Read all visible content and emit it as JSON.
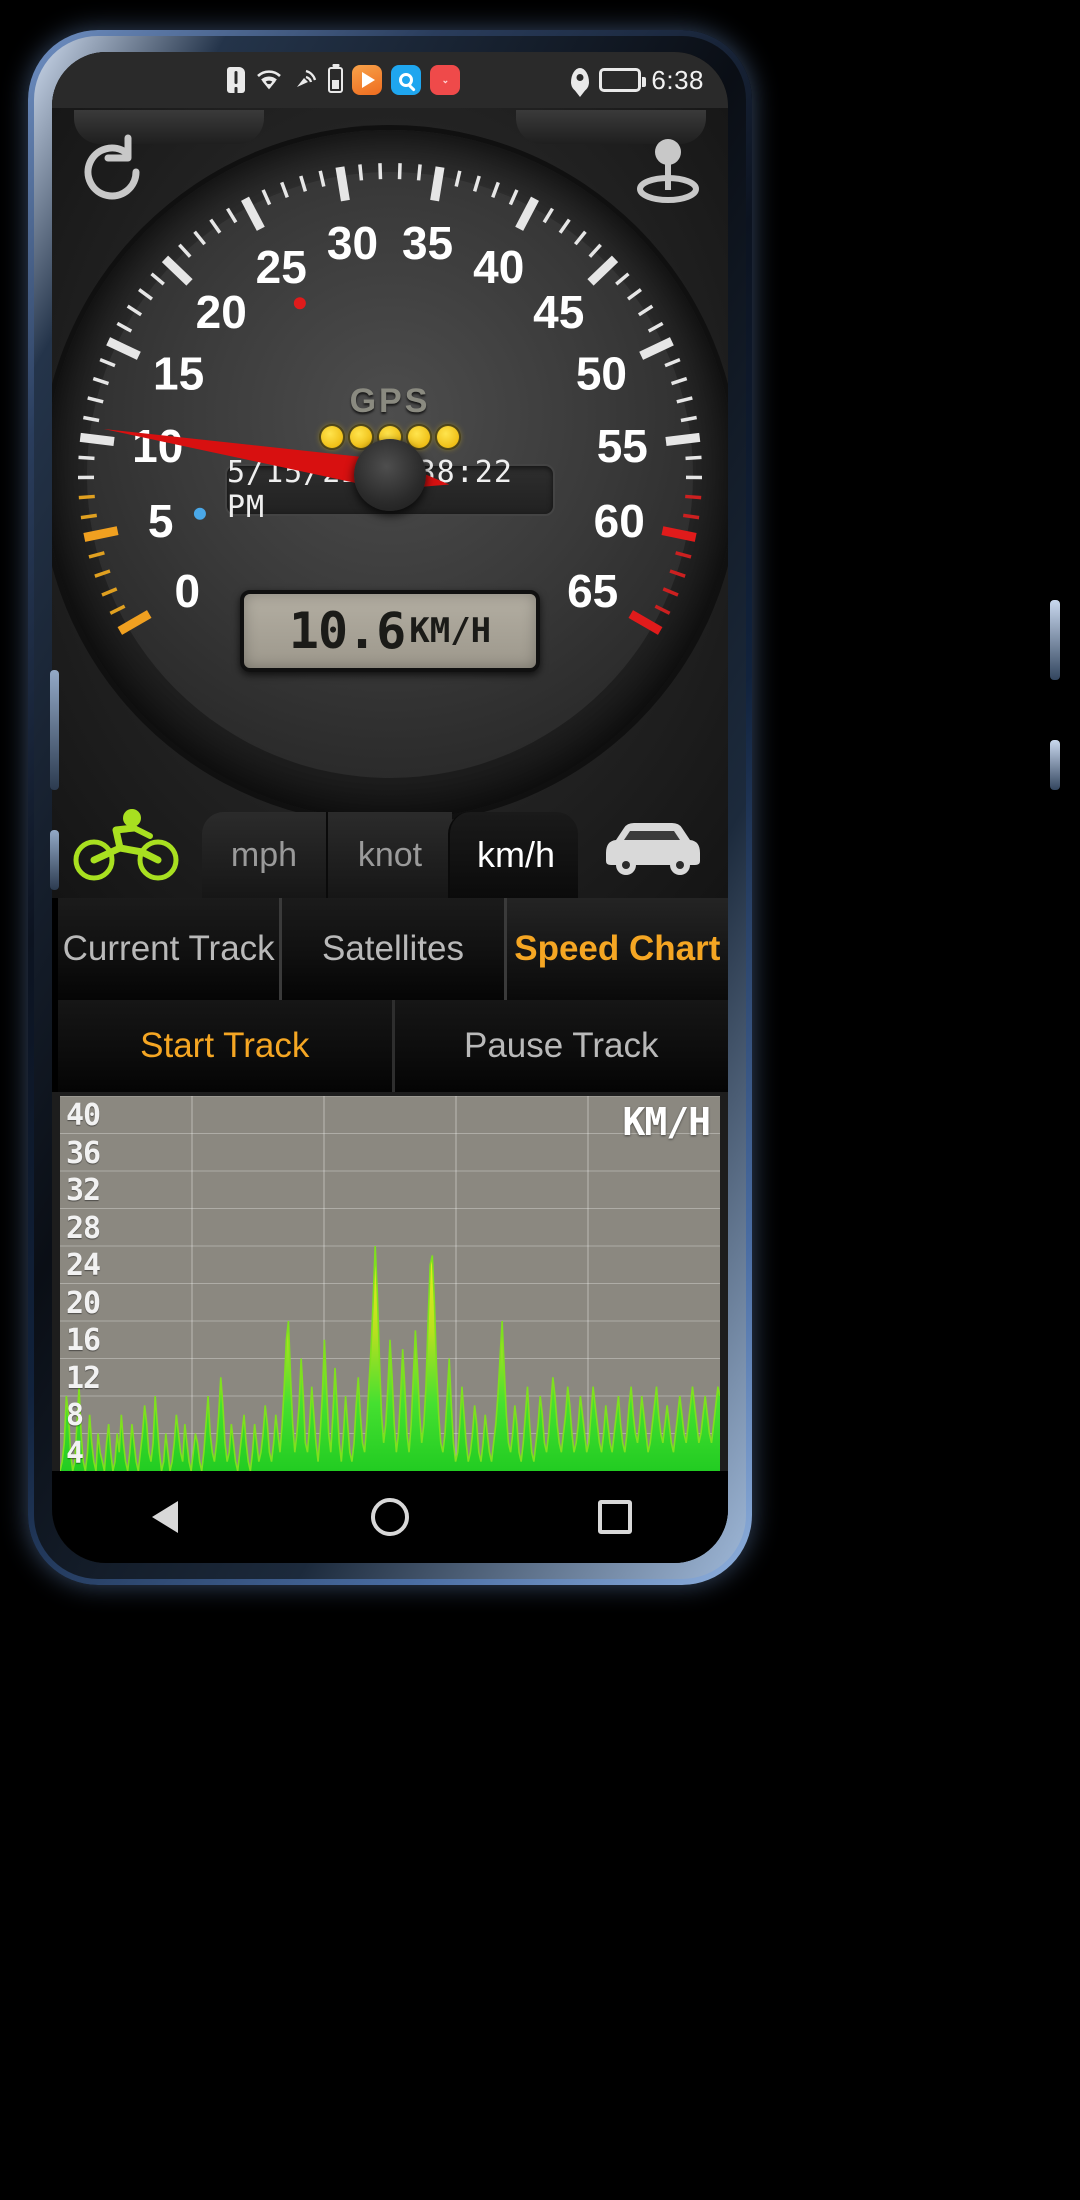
{
  "statusbar": {
    "icons": [
      "sim-alert-icon",
      "wifi-icon",
      "mobile-signal-icon",
      "battery-small-icon",
      "video-app-icon",
      "search-app-icon",
      "shopping-app-icon"
    ],
    "location_icon": "location-pin-icon",
    "battery_icon": "battery-icon",
    "time": "6:38"
  },
  "gauge": {
    "refresh_icon": "refresh-icon",
    "gps_fix_icon": "gps-fix-icon",
    "gps_label": "GPS",
    "gps_signal_dots": 5,
    "datetime": "5/15/22 6:38:22 PM",
    "speed_value": "10.6",
    "speed_unit": "KM/H",
    "needle_speed": 10.6,
    "scale_max": 65,
    "scale_min": 0,
    "major_ticks": [
      "0",
      "5",
      "10",
      "15",
      "20",
      "25",
      "30",
      "35",
      "40",
      "45",
      "50",
      "55",
      "60",
      "65"
    ],
    "accent_orange": "#f0a020",
    "accent_red": "#e01b1b",
    "needle_color": "#d81010"
  },
  "unit_bar": {
    "bicycle_icon": "bicycle-icon",
    "car_icon": "car-icon",
    "units": [
      {
        "label": "mph",
        "active": false
      },
      {
        "label": "knot",
        "active": false
      },
      {
        "label": "km/h",
        "active": true
      }
    ]
  },
  "main_tabs": [
    {
      "label": "Current Track",
      "active": false
    },
    {
      "label": "Satellites",
      "active": false
    },
    {
      "label": "Speed Chart",
      "active": true
    }
  ],
  "track_tabs": [
    {
      "label": "Start Track",
      "active": true
    },
    {
      "label": "Pause Track",
      "active": false
    }
  ],
  "chart_data": {
    "type": "area",
    "title": "",
    "unit_label": "KM/H",
    "ylabel": "",
    "xlabel": "",
    "ylim": [
      0,
      40
    ],
    "yticks": [
      40,
      36,
      32,
      28,
      24,
      20,
      16,
      12,
      8,
      4
    ],
    "grid": true,
    "gridlines_vertical": 4,
    "series": [
      {
        "name": "speed",
        "color_low": "#3ee03e",
        "color_high": "#e8e020",
        "values": [
          0,
          1,
          3,
          8,
          6,
          2,
          0,
          1,
          5,
          9,
          4,
          1,
          0,
          2,
          6,
          3,
          1,
          0,
          4,
          2,
          1,
          0,
          3,
          5,
          2,
          0,
          1,
          4,
          2,
          6,
          3,
          1,
          0,
          2,
          5,
          3,
          1,
          0,
          2,
          4,
          7,
          5,
          2,
          1,
          3,
          8,
          5,
          2,
          0,
          1,
          4,
          2,
          0,
          1,
          3,
          6,
          4,
          2,
          1,
          5,
          3,
          1,
          0,
          2,
          4,
          3,
          1,
          0,
          2,
          5,
          8,
          4,
          2,
          1,
          3,
          6,
          10,
          7,
          3,
          1,
          2,
          5,
          3,
          1,
          0,
          2,
          4,
          6,
          3,
          1,
          0,
          2,
          5,
          3,
          1,
          2,
          4,
          7,
          5,
          2,
          1,
          3,
          6,
          4,
          2,
          5,
          9,
          14,
          16,
          10,
          5,
          2,
          4,
          7,
          12,
          8,
          3,
          2,
          5,
          9,
          6,
          3,
          1,
          4,
          8,
          14,
          9,
          4,
          2,
          6,
          11,
          7,
          3,
          1,
          4,
          8,
          5,
          2,
          1,
          3,
          7,
          10,
          6,
          3,
          2,
          5,
          9,
          13,
          18,
          24,
          19,
          12,
          6,
          3,
          5,
          9,
          14,
          10,
          5,
          2,
          4,
          8,
          13,
          9,
          4,
          2,
          5,
          10,
          15,
          11,
          6,
          3,
          5,
          9,
          16,
          22,
          23,
          18,
          11,
          6,
          3,
          2,
          4,
          8,
          12,
          7,
          3,
          1,
          2,
          5,
          9,
          6,
          3,
          1,
          2,
          4,
          7,
          5,
          2,
          1,
          3,
          6,
          4,
          2,
          1,
          3,
          5,
          8,
          12,
          16,
          11,
          6,
          3,
          2,
          4,
          7,
          5,
          2,
          1,
          3,
          6,
          9,
          5,
          2,
          1,
          3,
          5,
          8,
          6,
          3,
          2,
          4,
          7,
          10,
          8,
          5,
          3,
          2,
          4,
          6,
          9,
          7,
          4,
          2,
          3,
          5,
          8,
          6,
          4,
          2,
          3,
          6,
          9,
          7,
          5,
          3,
          2,
          4,
          7,
          5,
          3,
          2,
          4,
          6,
          8,
          5,
          3,
          2,
          4,
          7,
          9,
          6,
          4,
          3,
          5,
          8,
          6,
          4,
          2,
          3,
          5,
          7,
          9,
          6,
          4,
          3,
          5,
          7,
          5,
          3,
          2,
          4,
          6,
          8,
          6,
          4,
          3,
          5,
          7,
          9,
          7,
          5,
          3,
          4,
          6,
          8,
          6,
          4,
          3,
          5,
          7,
          9,
          8
        ]
      }
    ]
  },
  "navbar": {
    "back_icon": "back-triangle-icon",
    "home_icon": "home-circle-icon",
    "recents_icon": "recents-square-icon"
  }
}
